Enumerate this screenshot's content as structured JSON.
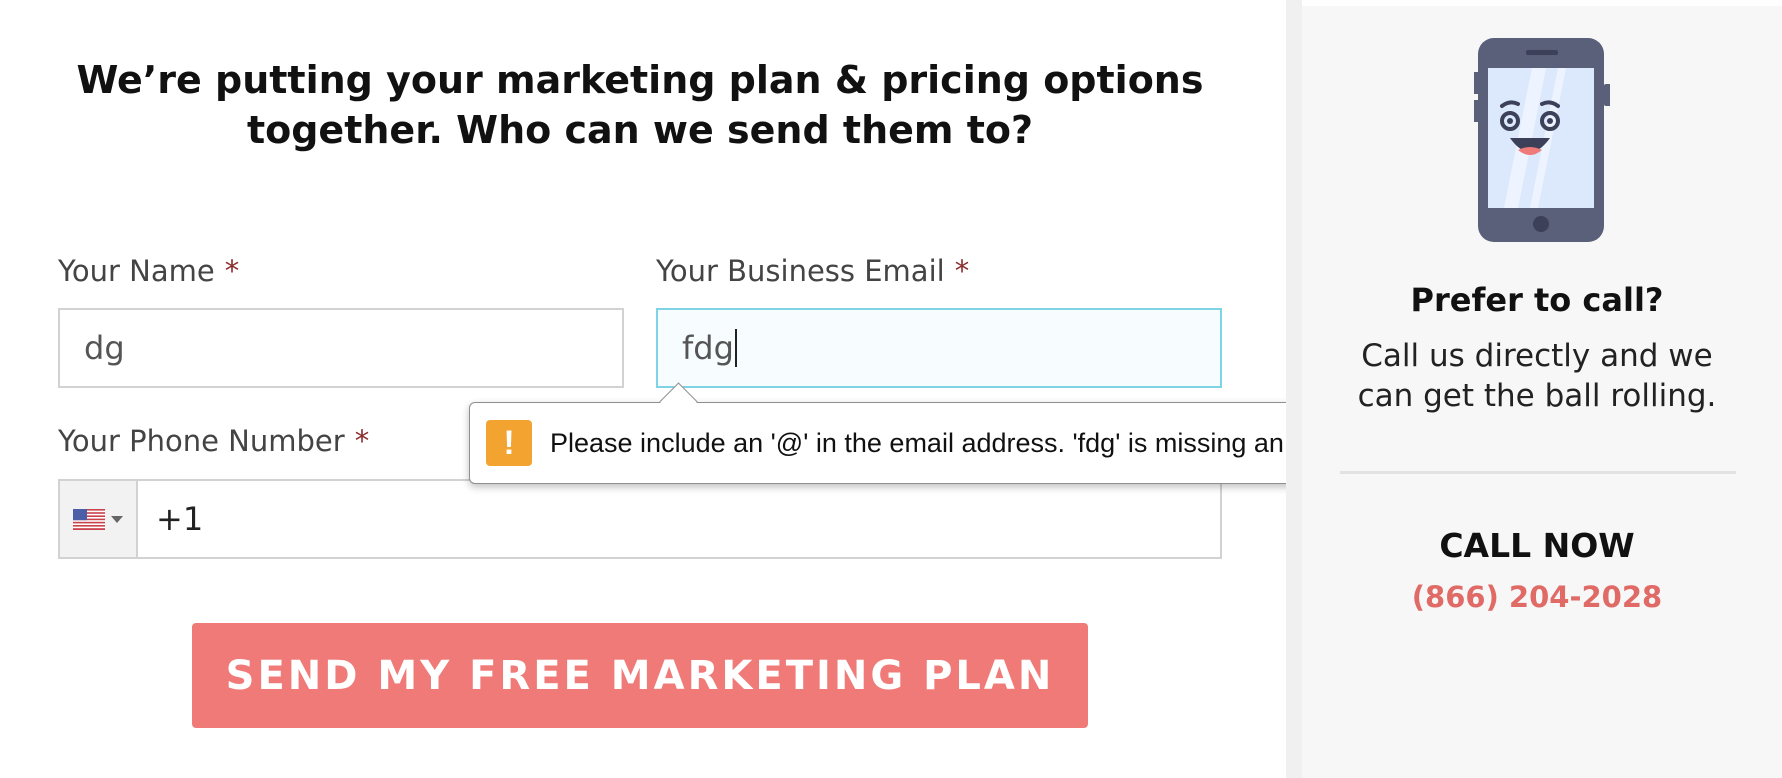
{
  "headline": {
    "line1": "We’re putting your marketing plan & pricing options",
    "line2": "together. Who can we send them to?"
  },
  "form": {
    "name": {
      "label": "Your Name",
      "required_mark": "*",
      "value": "dg"
    },
    "email": {
      "label": "Your Business Email",
      "required_mark": "*",
      "value": "fdg"
    },
    "phone": {
      "label": "Your Phone Number",
      "required_mark": "*",
      "country_flag": "us-flag-icon",
      "value": "+1"
    },
    "submit_label": "SEND MY FREE MARKETING PLAN"
  },
  "validation_tooltip": {
    "icon": "warning-icon",
    "icon_glyph": "!",
    "message": "Please include an '@' in the email address. 'fdg' is missing an '@'."
  },
  "sidebar": {
    "illustration": "smiling-phone-icon",
    "title": "Prefer to call?",
    "text": "Call us directly and we can get the ball rolling.",
    "call_label": "CALL NOW",
    "phone_number": "(866) 204-2028"
  },
  "colors": {
    "accent_button": "#f07a78",
    "phone_link": "#e06a66",
    "required": "#8b2e2e",
    "focus_border": "#7fd3e6",
    "warning": "#f3a330"
  }
}
